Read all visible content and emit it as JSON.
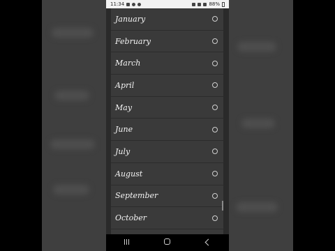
{
  "status_bar": {
    "time": "11:34",
    "battery": "88%"
  },
  "months": [
    {
      "label": "January",
      "selected": false
    },
    {
      "label": "February",
      "selected": false
    },
    {
      "label": "March",
      "selected": false
    },
    {
      "label": "April",
      "selected": false
    },
    {
      "label": "May",
      "selected": false
    },
    {
      "label": "June",
      "selected": false
    },
    {
      "label": "July",
      "selected": false
    },
    {
      "label": "August",
      "selected": false
    },
    {
      "label": "September",
      "selected": false
    },
    {
      "label": "October",
      "selected": false
    }
  ],
  "nav_bar": {
    "icons": [
      "recents-icon",
      "home-icon",
      "back-icon"
    ]
  }
}
